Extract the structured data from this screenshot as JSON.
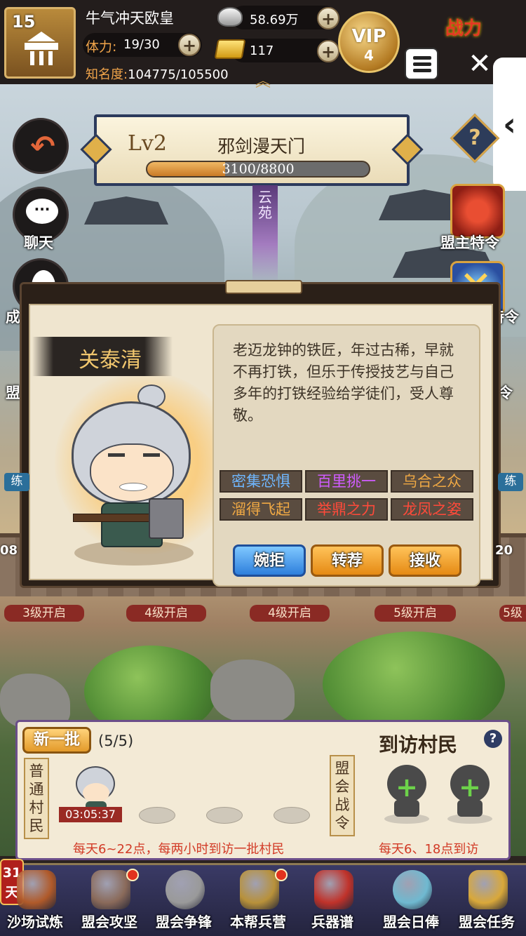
{
  "player": {
    "level": "15",
    "name": "牛气冲天欧皇",
    "stamina_label": "体力:",
    "stamina_value": "19/30",
    "fame_label": "知名度:",
    "fame_value": "104775/105500",
    "silver": "58.69万",
    "gold": "117",
    "vip_label": "VIP",
    "vip_level": "4",
    "power_label": "战力"
  },
  "guild": {
    "level": "Lv2",
    "name": "邪剑漫天门",
    "exp_text": "3100/8800",
    "exp_fraction": 0.352,
    "ribbon_text": "云苑"
  },
  "left_buttons": {
    "chat_label": "聊天",
    "chat_glyph": "···",
    "back_glyph": "↶",
    "partial_1": "成",
    "partial_2": "盟"
  },
  "right_buttons": {
    "help_glyph": "?",
    "leader_order_label": "盟主特令",
    "partial_order": "特令",
    "partial_3": "令"
  },
  "npc": {
    "name": "关泰清",
    "description": "老迈龙钟的铁匠，年过古稀，早就不再打铁，但乐于传授技艺与自己多年的打铁经验给学徒们，受人尊敬。",
    "traits": [
      {
        "label": "密集恐惧",
        "color": "#6fb7ff"
      },
      {
        "label": "百里挑一",
        "color": "#d05cff"
      },
      {
        "label": "乌合之众",
        "color": "#f0a944"
      },
      {
        "label": "溜得飞起",
        "color": "#f0a944"
      },
      {
        "label": "举鼎之力",
        "color": "#ff4a3a"
      },
      {
        "label": "龙凤之姿",
        "color": "#ff4a3a"
      }
    ],
    "buttons": {
      "decline": "婉拒",
      "recommend": "转荐",
      "accept": "接收"
    }
  },
  "slots": {
    "labels": [
      "3级开启",
      "4级开启",
      "4级开启",
      "5级开启",
      "5级"
    ],
    "left_badge": "练",
    "right_badge": "练",
    "left_level": "08",
    "right_level": "20"
  },
  "visitors": {
    "new_batch_label": "新一批",
    "count": "(5/5)",
    "title": "到访村民",
    "help_glyph": "?",
    "common_tag": "普通村民",
    "war_tag": "盟会战令",
    "timer": "03:05:37",
    "note_common": "每天6~22点，每两小时到访一批村民",
    "note_war": "每天6、18点到访",
    "add_glyph": "+"
  },
  "bottom_nav": {
    "days_number": "31",
    "days_unit": "天",
    "items": [
      {
        "label": "沙场试炼",
        "dot": false,
        "color": "#b05a2a"
      },
      {
        "label": "盟会攻坚",
        "dot": true,
        "color": "#8a6a5a"
      },
      {
        "label": "盟会争锋",
        "dot": false,
        "color": "#9a9a9a"
      },
      {
        "label": "本帮兵营",
        "dot": true,
        "color": "#b8913a"
      },
      {
        "label": "兵器谱",
        "dot": false,
        "color": "#c0322a"
      },
      {
        "label": "盟会日俸",
        "dot": false,
        "color": "#6fb9d0"
      },
      {
        "label": "盟会任务",
        "dot": false,
        "color": "#d9a83a"
      }
    ]
  }
}
